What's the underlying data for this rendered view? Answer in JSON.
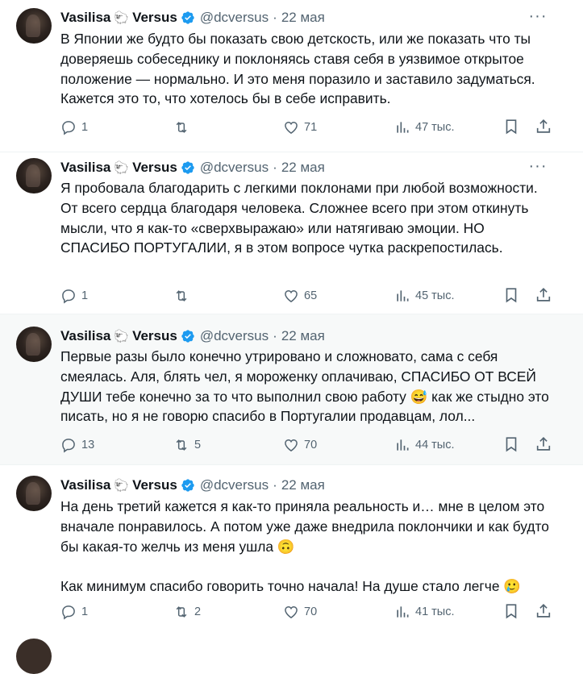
{
  "tweets": [
    {
      "name": "Vasilisa",
      "name_emoji": "🐑",
      "name_suffix": "Versus",
      "handle": "@dcversus",
      "date": "22 мая",
      "text": "В Японии же будто бы показать свою детскость, или же показать что ты доверяешь собеседнику и поклоняясь ставя себя в уязвимое открытое положение — нормально. И это меня поразило и заставило задуматься. Кажется это то, что хотелось бы в себе исправить.",
      "replies": "1",
      "retweets": "",
      "likes": "71",
      "views": "47 тыс."
    },
    {
      "name": "Vasilisa",
      "name_emoji": "🐑",
      "name_suffix": "Versus",
      "handle": "@dcversus",
      "date": "22 мая",
      "text": "Я пробовала благодарить с легкими поклонами при любой возможности. От всего сердца благодаря человека. Сложнее всего при этом откинуть мысли, что я как-то «сверхвыражаю» или натягиваю эмоции. НО СПАСИБО ПОРТУГАЛИИ, я в этом вопросе чутка раскрепостилась.",
      "replies": "1",
      "retweets": "",
      "likes": "65",
      "views": "45 тыс."
    },
    {
      "name": "Vasilisa",
      "name_emoji": "🐑",
      "name_suffix": "Versus",
      "handle": "@dcversus",
      "date": "22 мая",
      "text": "Первые разы было конечно утрировано и сложновато, сама с себя смеялась. Аля, блять чел, я мороженку оплачиваю, СПАСИБО ОТ ВСЕЙ ДУШИ тебе конечно за то что выполнил свою работу 😅 как же стыдно это писать, но я не говорю спасибо в Португалии продавцам, лол...",
      "replies": "13",
      "retweets": "5",
      "likes": "70",
      "views": "44 тыс."
    },
    {
      "name": "Vasilisa",
      "name_emoji": "🐑",
      "name_suffix": "Versus",
      "handle": "@dcversus",
      "date": "22 мая",
      "text": "На день третий кажется я как-то приняла реальность и… мне в целом это вначале понравилось. А потом уже даже внедрила поклончики и как будто бы какая-то желчь из меня ушла 🙃\n\nКак минимум спасибо говорить точно начала! На душе стало легче 🥲",
      "replies": "1",
      "retweets": "2",
      "likes": "70",
      "views": "41 тыс."
    }
  ],
  "colors": {
    "text": "#0f1419",
    "muted": "#536471",
    "verified": "#1d9bf0",
    "highlight_bg": "#f7f9f9",
    "divider": "#eff3f4"
  },
  "icons": [
    "reply-icon",
    "retweet-icon",
    "like-icon",
    "views-icon",
    "bookmark-icon",
    "share-icon",
    "more-icon",
    "verified-icon"
  ]
}
